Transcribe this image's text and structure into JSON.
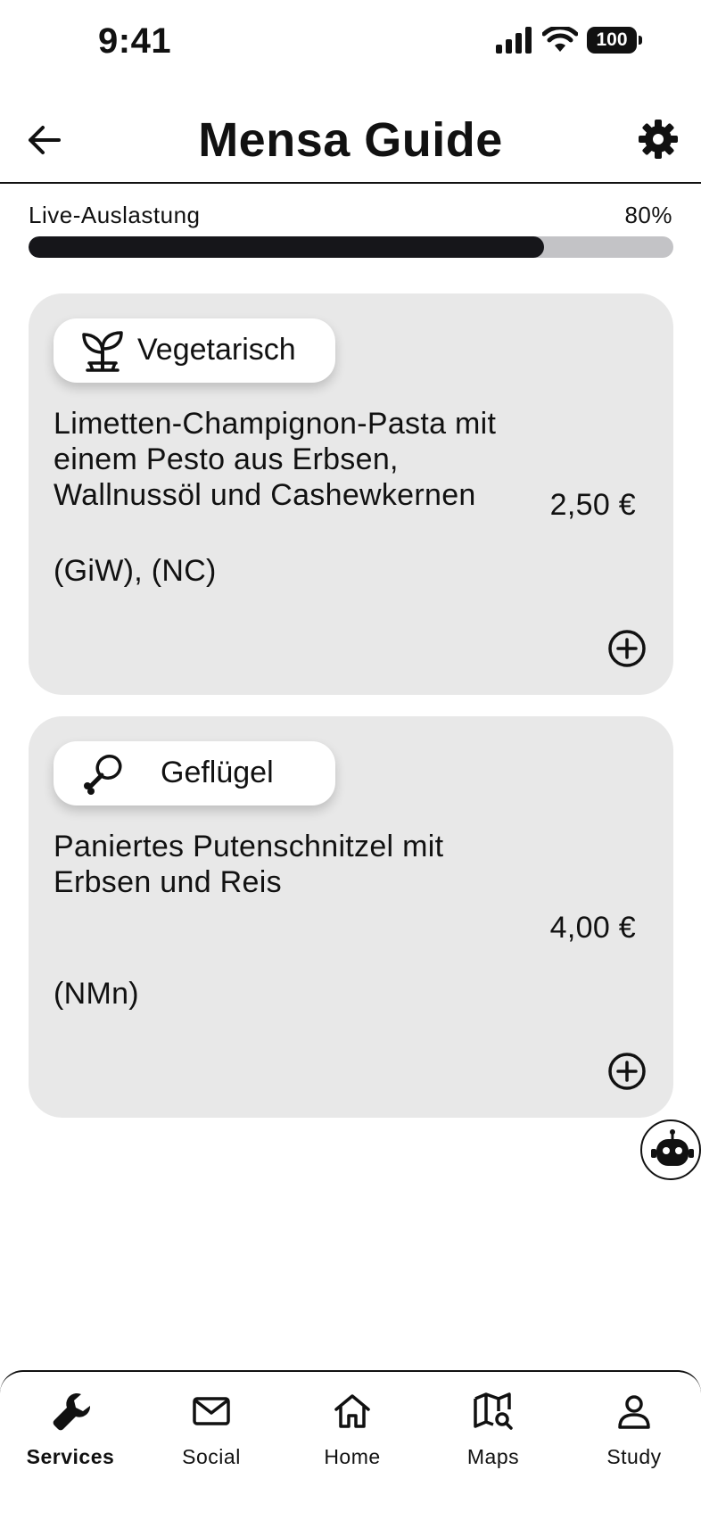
{
  "status_bar": {
    "time": "9:41",
    "battery": "100"
  },
  "header": {
    "title": "Mensa Guide"
  },
  "occupancy": {
    "label": "Live-Auslastung",
    "value_text": "80%",
    "fraction": 0.8
  },
  "meals": [
    {
      "category": "Vegetarisch",
      "category_icon": "sprout-icon",
      "name": "Limetten-Champignon-Pasta mit einem Pesto aus Erbsen, Wallnussöl und Cashewkernen",
      "price": "2,50 €",
      "allergens": "(GiW), (NC)"
    },
    {
      "category": "Geflügel",
      "category_icon": "drumstick-icon",
      "name": "Paniertes Putenschnitzel mit Erbsen und Reis",
      "price": "4,00 €",
      "allergens": "(NMn)"
    }
  ],
  "nav": {
    "active": "Services",
    "items": [
      {
        "label": "Services",
        "icon": "wrench-icon"
      },
      {
        "label": "Social",
        "icon": "mail-icon"
      },
      {
        "label": "Home",
        "icon": "home-icon"
      },
      {
        "label": "Maps",
        "icon": "map-search-icon"
      },
      {
        "label": "Study",
        "icon": "user-icon"
      }
    ]
  }
}
